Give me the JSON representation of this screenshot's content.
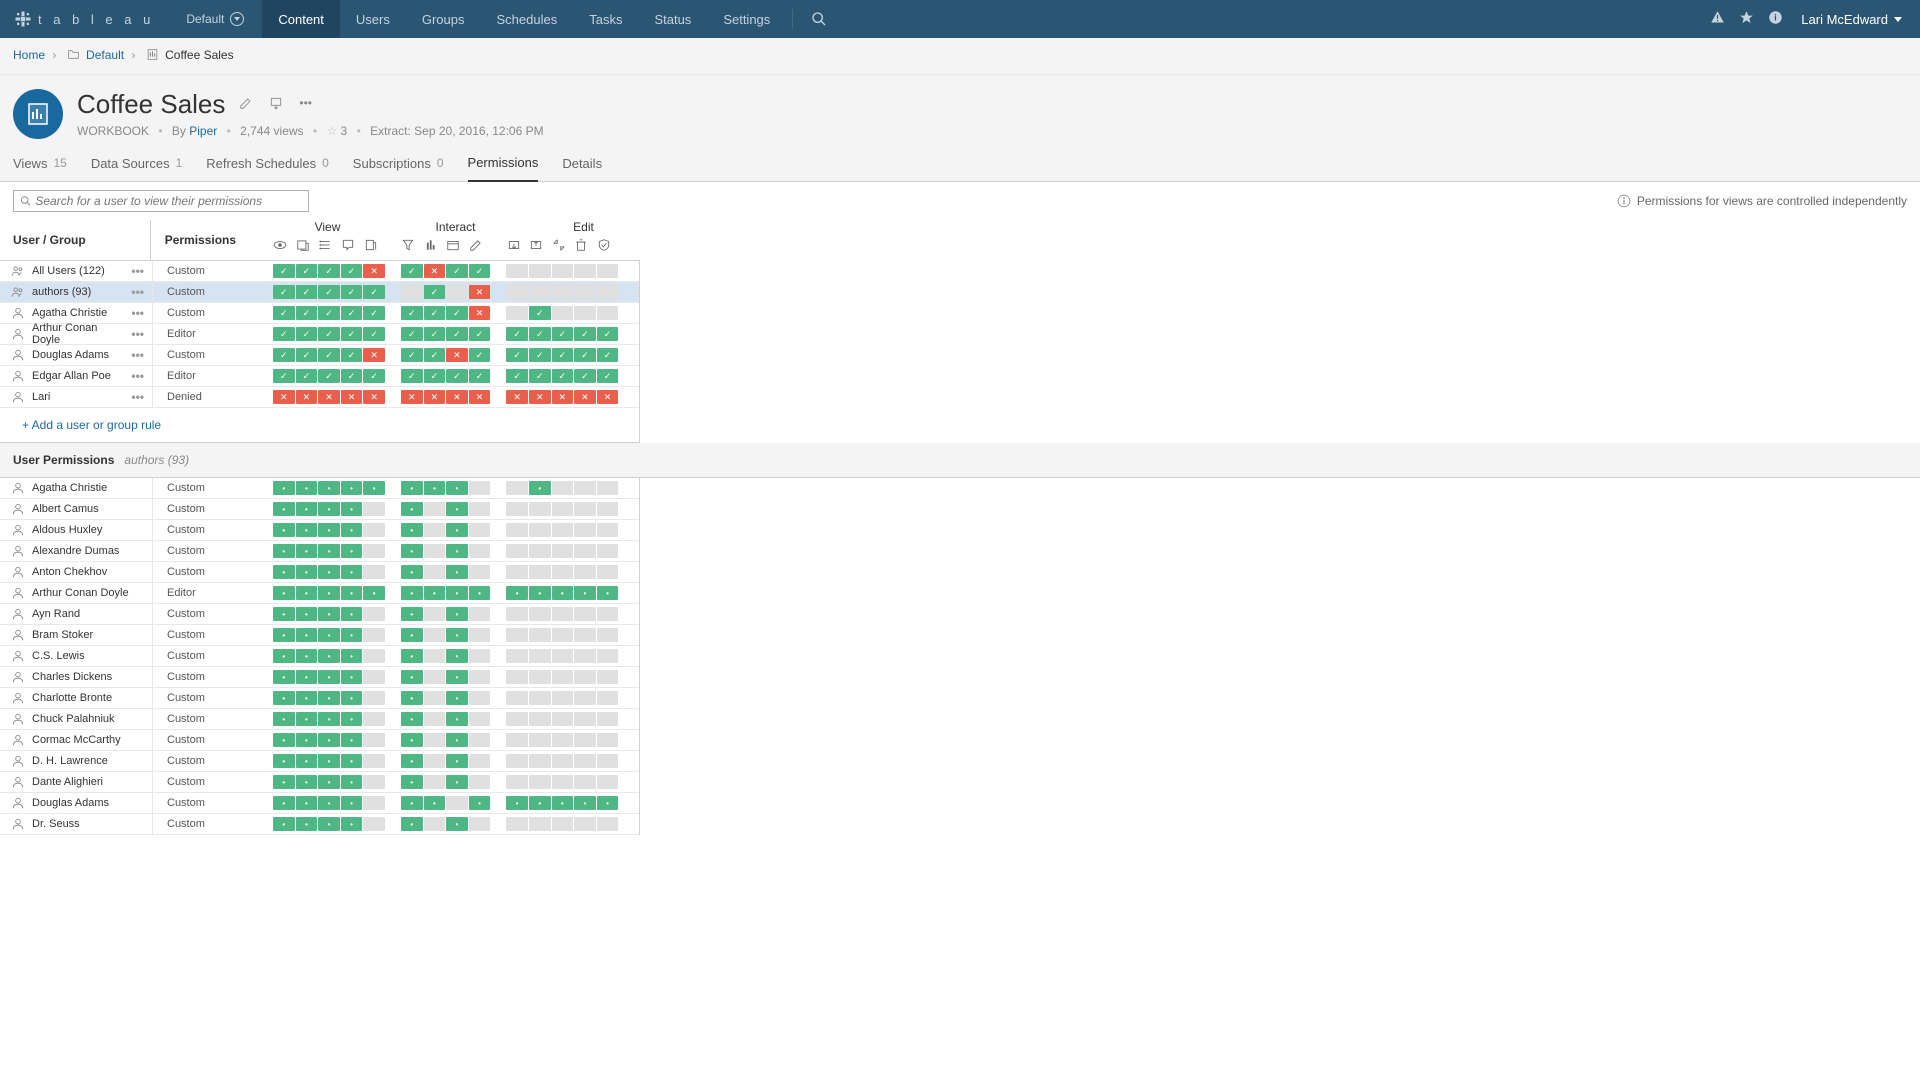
{
  "topbar": {
    "brand": "t a b l e a u",
    "site": "Default",
    "nav": [
      "Content",
      "Users",
      "Groups",
      "Schedules",
      "Tasks",
      "Status",
      "Settings"
    ],
    "nav_active": 0,
    "user": "Lari McEdward"
  },
  "breadcrumb": {
    "home": "Home",
    "items": [
      "Default",
      "Coffee Sales"
    ]
  },
  "workbook": {
    "title": "Coffee Sales",
    "type_label": "WORKBOOK",
    "by_label": "By",
    "owner": "Piper",
    "views": "2,744 views",
    "fav_count": "3",
    "extract_label": "Extract:",
    "extract_time": "Sep 20, 2016, 12:06 PM"
  },
  "tabs": [
    {
      "label": "Views",
      "count": "15"
    },
    {
      "label": "Data Sources",
      "count": "1"
    },
    {
      "label": "Refresh Schedules",
      "count": "0"
    },
    {
      "label": "Subscriptions",
      "count": "0"
    },
    {
      "label": "Permissions",
      "count": ""
    },
    {
      "label": "Details",
      "count": ""
    }
  ],
  "tabs_active": 4,
  "search": {
    "placeholder": "Search for a user to view their permissions"
  },
  "info_note": "Permissions for views are controlled independently",
  "headers": {
    "user_group": "User / Group",
    "permissions": "Permissions",
    "groups": [
      "View",
      "Interact",
      "Edit"
    ]
  },
  "add_rule": "+ Add a user or group rule",
  "rules": [
    {
      "icon": "group",
      "name": "All Users (122)",
      "perm": "Custom",
      "view": [
        "a",
        "a",
        "a",
        "a",
        "d"
      ],
      "interact": [
        "a",
        "d",
        "a",
        "a"
      ],
      "edit": [
        "u",
        "u",
        "u",
        "u",
        "u"
      ]
    },
    {
      "icon": "group",
      "name": "authors (93)",
      "perm": "Custom",
      "selected": true,
      "view": [
        "a",
        "a",
        "a",
        "a",
        "a"
      ],
      "interact": [
        "u",
        "a",
        "u",
        "d"
      ],
      "edit": [
        "u",
        "u",
        "u",
        "u",
        "u"
      ]
    },
    {
      "icon": "user",
      "name": "Agatha Christie",
      "perm": "Custom",
      "view": [
        "a",
        "a",
        "a",
        "a",
        "a"
      ],
      "interact": [
        "a",
        "a",
        "a",
        "d"
      ],
      "edit": [
        "u",
        "a",
        "u",
        "u",
        "u"
      ]
    },
    {
      "icon": "user",
      "name": "Arthur Conan Doyle",
      "perm": "Editor",
      "view": [
        "a",
        "a",
        "a",
        "a",
        "a"
      ],
      "interact": [
        "a",
        "a",
        "a",
        "a"
      ],
      "edit": [
        "a",
        "a",
        "a",
        "a",
        "a"
      ]
    },
    {
      "icon": "user",
      "name": "Douglas Adams",
      "perm": "Custom",
      "view": [
        "a",
        "a",
        "a",
        "a",
        "d"
      ],
      "interact": [
        "a",
        "a",
        "d",
        "a"
      ],
      "edit": [
        "a",
        "a",
        "a",
        "a",
        "a"
      ]
    },
    {
      "icon": "user",
      "name": "Edgar Allan Poe",
      "perm": "Editor",
      "view": [
        "a",
        "a",
        "a",
        "a",
        "a"
      ],
      "interact": [
        "a",
        "a",
        "a",
        "a"
      ],
      "edit": [
        "a",
        "a",
        "a",
        "a",
        "a"
      ]
    },
    {
      "icon": "user",
      "name": "Lari",
      "perm": "Denied",
      "view": [
        "d",
        "d",
        "d",
        "d",
        "d"
      ],
      "interact": [
        "d",
        "d",
        "d",
        "d"
      ],
      "edit": [
        "d",
        "d",
        "d",
        "d",
        "d"
      ]
    }
  ],
  "user_perms": {
    "label": "User Permissions",
    "sub": "authors (93)",
    "rows": [
      {
        "name": "Agatha Christie",
        "perm": "Custom",
        "view": [
          "p",
          "p",
          "p",
          "p",
          "p"
        ],
        "interact": [
          "p",
          "p",
          "p",
          "u"
        ],
        "edit": [
          "u",
          "p",
          "u",
          "u",
          "u"
        ]
      },
      {
        "name": "Albert Camus",
        "perm": "Custom",
        "view": [
          "p",
          "p",
          "p",
          "p",
          "u"
        ],
        "interact": [
          "p",
          "u",
          "p",
          "u"
        ],
        "edit": [
          "u",
          "u",
          "u",
          "u",
          "u"
        ]
      },
      {
        "name": "Aldous Huxley",
        "perm": "Custom",
        "view": [
          "p",
          "p",
          "p",
          "p",
          "u"
        ],
        "interact": [
          "p",
          "u",
          "p",
          "u"
        ],
        "edit": [
          "u",
          "u",
          "u",
          "u",
          "u"
        ]
      },
      {
        "name": "Alexandre Dumas",
        "perm": "Custom",
        "view": [
          "p",
          "p",
          "p",
          "p",
          "u"
        ],
        "interact": [
          "p",
          "u",
          "p",
          "u"
        ],
        "edit": [
          "u",
          "u",
          "u",
          "u",
          "u"
        ]
      },
      {
        "name": "Anton Chekhov",
        "perm": "Custom",
        "view": [
          "p",
          "p",
          "p",
          "p",
          "u"
        ],
        "interact": [
          "p",
          "u",
          "p",
          "u"
        ],
        "edit": [
          "u",
          "u",
          "u",
          "u",
          "u"
        ]
      },
      {
        "name": "Arthur Conan Doyle",
        "perm": "Editor",
        "view": [
          "p",
          "p",
          "p",
          "p",
          "p"
        ],
        "interact": [
          "p",
          "p",
          "p",
          "p"
        ],
        "edit": [
          "p",
          "p",
          "p",
          "p",
          "p"
        ]
      },
      {
        "name": "Ayn Rand",
        "perm": "Custom",
        "view": [
          "p",
          "p",
          "p",
          "p",
          "u"
        ],
        "interact": [
          "p",
          "u",
          "p",
          "u"
        ],
        "edit": [
          "u",
          "u",
          "u",
          "u",
          "u"
        ]
      },
      {
        "name": "Bram Stoker",
        "perm": "Custom",
        "view": [
          "p",
          "p",
          "p",
          "p",
          "u"
        ],
        "interact": [
          "p",
          "u",
          "p",
          "u"
        ],
        "edit": [
          "u",
          "u",
          "u",
          "u",
          "u"
        ]
      },
      {
        "name": "C.S. Lewis",
        "perm": "Custom",
        "view": [
          "p",
          "p",
          "p",
          "p",
          "u"
        ],
        "interact": [
          "p",
          "u",
          "p",
          "u"
        ],
        "edit": [
          "u",
          "u",
          "u",
          "u",
          "u"
        ]
      },
      {
        "name": "Charles Dickens",
        "perm": "Custom",
        "view": [
          "p",
          "p",
          "p",
          "p",
          "u"
        ],
        "interact": [
          "p",
          "u",
          "p",
          "u"
        ],
        "edit": [
          "u",
          "u",
          "u",
          "u",
          "u"
        ]
      },
      {
        "name": "Charlotte Bronte",
        "perm": "Custom",
        "view": [
          "p",
          "p",
          "p",
          "p",
          "u"
        ],
        "interact": [
          "p",
          "u",
          "p",
          "u"
        ],
        "edit": [
          "u",
          "u",
          "u",
          "u",
          "u"
        ]
      },
      {
        "name": "Chuck Palahniuk",
        "perm": "Custom",
        "view": [
          "p",
          "p",
          "p",
          "p",
          "u"
        ],
        "interact": [
          "p",
          "u",
          "p",
          "u"
        ],
        "edit": [
          "u",
          "u",
          "u",
          "u",
          "u"
        ]
      },
      {
        "name": "Cormac McCarthy",
        "perm": "Custom",
        "view": [
          "p",
          "p",
          "p",
          "p",
          "u"
        ],
        "interact": [
          "p",
          "u",
          "p",
          "u"
        ],
        "edit": [
          "u",
          "u",
          "u",
          "u",
          "u"
        ]
      },
      {
        "name": "D. H. Lawrence",
        "perm": "Custom",
        "view": [
          "p",
          "p",
          "p",
          "p",
          "u"
        ],
        "interact": [
          "p",
          "u",
          "p",
          "u"
        ],
        "edit": [
          "u",
          "u",
          "u",
          "u",
          "u"
        ]
      },
      {
        "name": "Dante Alighieri",
        "perm": "Custom",
        "view": [
          "p",
          "p",
          "p",
          "p",
          "u"
        ],
        "interact": [
          "p",
          "u",
          "p",
          "u"
        ],
        "edit": [
          "u",
          "u",
          "u",
          "u",
          "u"
        ]
      },
      {
        "name": "Douglas Adams",
        "perm": "Custom",
        "view": [
          "p",
          "p",
          "p",
          "p",
          "u"
        ],
        "interact": [
          "p",
          "p",
          "u",
          "p"
        ],
        "edit": [
          "p",
          "p",
          "p",
          "p",
          "p"
        ]
      },
      {
        "name": "Dr. Seuss",
        "perm": "Custom",
        "view": [
          "p",
          "p",
          "p",
          "p",
          "u"
        ],
        "interact": [
          "p",
          "u",
          "p",
          "u"
        ],
        "edit": [
          "u",
          "u",
          "u",
          "u",
          "u"
        ]
      }
    ]
  }
}
